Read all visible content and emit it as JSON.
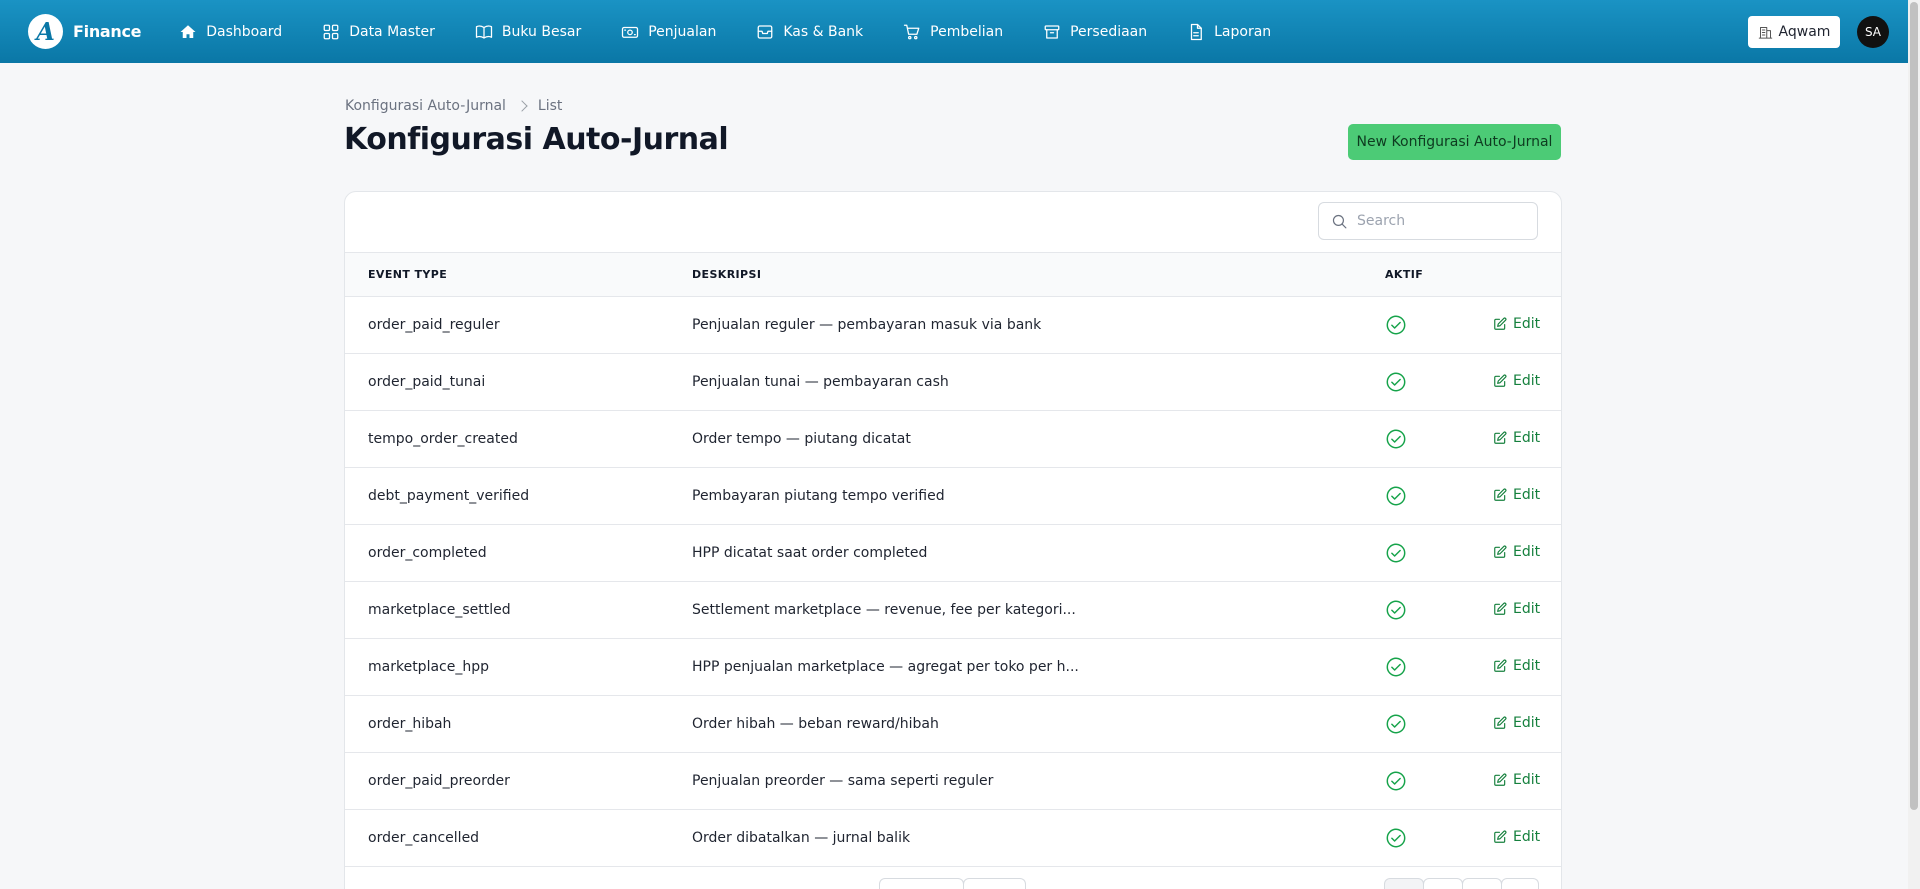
{
  "brand": {
    "logo_letter": "A",
    "name": "Finance"
  },
  "nav": [
    {
      "label": "Dashboard",
      "icon": "home-icon"
    },
    {
      "label": "Data Master",
      "icon": "grid-icon"
    },
    {
      "label": "Buku Besar",
      "icon": "book-icon"
    },
    {
      "label": "Penjualan",
      "icon": "banknote-icon"
    },
    {
      "label": "Kas & Bank",
      "icon": "archive-icon"
    },
    {
      "label": "Pembelian",
      "icon": "cart-icon"
    },
    {
      "label": "Persediaan",
      "icon": "box-icon"
    },
    {
      "label": "Laporan",
      "icon": "report-icon"
    }
  ],
  "org": {
    "label": "Aqwam",
    "icon": "building-icon"
  },
  "user": {
    "initials": "SA"
  },
  "breadcrumb": {
    "parent": "Konfigurasi Auto-Jurnal",
    "current": "List"
  },
  "page": {
    "title": "Konfigurasi Auto-Jurnal",
    "new_button": "New Konfigurasi Auto-Jurnal"
  },
  "search": {
    "placeholder": "Search"
  },
  "table": {
    "headers": {
      "event_type": "EVENT TYPE",
      "deskripsi": "DESKRIPSI",
      "aktif": "AKTIF"
    },
    "edit_label": "Edit",
    "rows": [
      {
        "event_type": "order_paid_reguler",
        "deskripsi": "Penjualan reguler — pembayaran masuk via bank",
        "aktif": true
      },
      {
        "event_type": "order_paid_tunai",
        "deskripsi": "Penjualan tunai — pembayaran cash",
        "aktif": true
      },
      {
        "event_type": "tempo_order_created",
        "deskripsi": "Order tempo — piutang dicatat",
        "aktif": true
      },
      {
        "event_type": "debt_payment_verified",
        "deskripsi": "Pembayaran piutang tempo verified",
        "aktif": true
      },
      {
        "event_type": "order_completed",
        "deskripsi": "HPP dicatat saat order completed",
        "aktif": true
      },
      {
        "event_type": "marketplace_settled",
        "deskripsi": "Settlement marketplace — revenue, fee per kategori...",
        "aktif": true
      },
      {
        "event_type": "marketplace_hpp",
        "deskripsi": "HPP penjualan marketplace — agregat per toko per h...",
        "aktif": true
      },
      {
        "event_type": "order_hibah",
        "deskripsi": "Order hibah — beban reward/hibah",
        "aktif": true
      },
      {
        "event_type": "order_paid_preorder",
        "deskripsi": "Penjualan preorder — sama seperti reguler",
        "aktif": true
      },
      {
        "event_type": "order_cancelled",
        "deskripsi": "Order dibatalkan — jurnal balik",
        "aktif": true
      }
    ]
  },
  "colors": {
    "topbar": "#0a77a6",
    "accent_green": "#4ccb76",
    "check_green": "#16a34a"
  }
}
